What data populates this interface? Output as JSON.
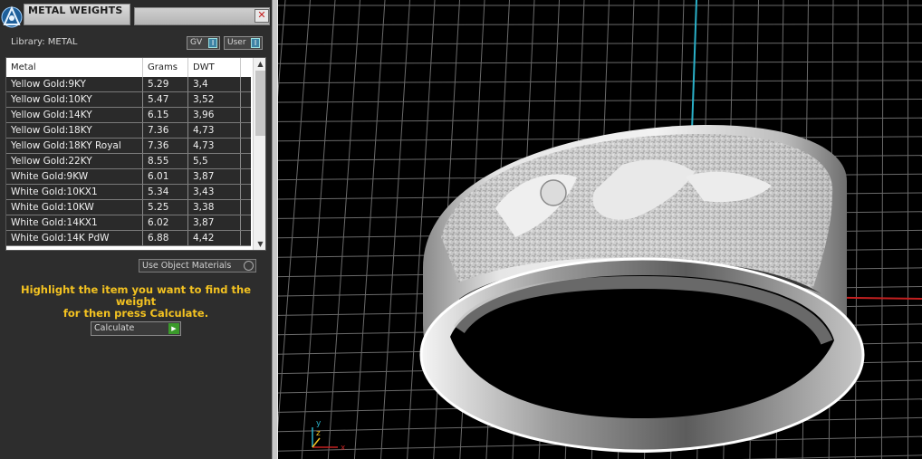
{
  "panel": {
    "title": "METAL WEIGHTS",
    "close_glyph": "✕",
    "library_label": "Library: METAL",
    "toggles": [
      {
        "label": "GV",
        "indicator": "I"
      },
      {
        "label": "User",
        "indicator": "I"
      }
    ],
    "table": {
      "headers": [
        "Metal",
        "Grams",
        "DWT"
      ],
      "rows": [
        [
          "Yellow Gold:9KY",
          "5.29",
          "3,4"
        ],
        [
          "Yellow Gold:10KY",
          "5.47",
          "3,52"
        ],
        [
          "Yellow Gold:14KY",
          "6.15",
          "3,96"
        ],
        [
          "Yellow Gold:18KY",
          "7.36",
          "4,73"
        ],
        [
          "Yellow Gold:18KY Royal",
          "7.36",
          "4,73"
        ],
        [
          "Yellow Gold:22KY",
          "8.55",
          "5,5"
        ],
        [
          "White Gold:9KW",
          "6.01",
          "3,87"
        ],
        [
          "White Gold:10KX1",
          "5.34",
          "3,43"
        ],
        [
          "White Gold:10KW",
          "5.25",
          "3,38"
        ],
        [
          "White Gold:14KX1",
          "6.02",
          "3,87"
        ],
        [
          "White Gold:14K PdW",
          "6.88",
          "4,42"
        ]
      ]
    },
    "use_object_materials": "Use Object Materials",
    "hint_line1": "Highlight the item you want to find the weight",
    "hint_line2": "for then press Calculate.",
    "calculate_label": "Calculate"
  },
  "viewport": {
    "axis_labels": {
      "y": "y",
      "z": "z",
      "x": "x"
    },
    "colors": {
      "grid": "#6a6a6a",
      "y_axis": "#2ab0c8",
      "x_axis": "#c42020",
      "ring": "#d8d8d8",
      "highlight": "#f3c221"
    }
  }
}
